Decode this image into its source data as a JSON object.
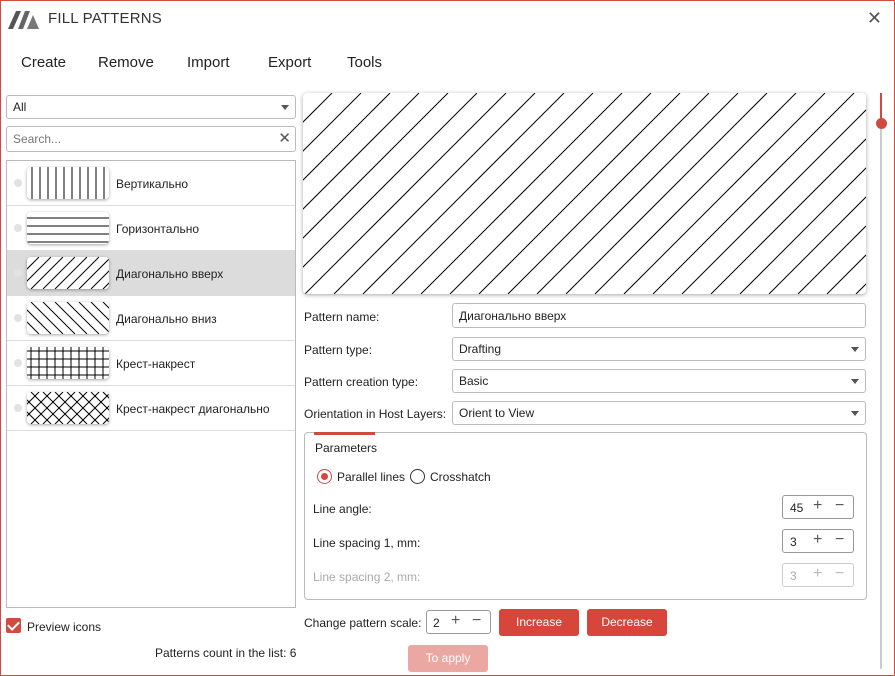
{
  "window": {
    "title": "FILL PATTERNS",
    "close_symbol": "✕"
  },
  "menu": {
    "items": [
      "Create",
      "Remove",
      "Import",
      "Export",
      "Tools"
    ]
  },
  "filter": {
    "selected": "All"
  },
  "search": {
    "placeholder": "Search...",
    "value": ""
  },
  "patterns": [
    {
      "label": "Вертикально",
      "pattern": "vertical",
      "selected": false
    },
    {
      "label": "Горизонтально",
      "pattern": "horizontal",
      "selected": false
    },
    {
      "label": "Диагонально вверх",
      "pattern": "diagonal-up",
      "selected": true
    },
    {
      "label": "Диагонально вниз",
      "pattern": "diagonal-down",
      "selected": false
    },
    {
      "label": "Крест-накрест",
      "pattern": "crosshatch",
      "selected": false
    },
    {
      "label": "Крест-накрест диагонально",
      "pattern": "diagonal-crosshatch",
      "selected": false
    }
  ],
  "properties": {
    "name_label": "Pattern name:",
    "name_value": "Диагонально вверх",
    "type_label": "Pattern type:",
    "type_value": "Drafting",
    "creation_label": "Pattern creation type:",
    "creation_value": "Basic",
    "orientation_label": "Orientation in Host Layers:",
    "orientation_value": "Orient to View"
  },
  "parameters": {
    "title": "Parameters",
    "parallel_label": "Parallel lines",
    "crosshatch_label": "Crosshatch",
    "selected_mode": "Parallel lines",
    "angle_label": "Line angle:",
    "angle_value": "45",
    "spacing1_label": "Line spacing 1, mm:",
    "spacing1_value": "3",
    "spacing2_label": "Line spacing 2, mm:",
    "spacing2_value": "3"
  },
  "scale": {
    "label": "Change pattern scale:",
    "value": "2",
    "increase_label": "Increase",
    "decrease_label": "Decrease"
  },
  "stepper_symbols": {
    "plus": "+",
    "minus": "−"
  },
  "apply_label": "To apply",
  "preview_icons_label": "Preview icons",
  "count_text": "Patterns count in the list: 6",
  "colors": {
    "accent": "#d04a42",
    "button": "#d8453b",
    "button_disabled": "#eba8a3",
    "selected_row": "#dcdcdc"
  },
  "icons": {
    "logo": "app-logo",
    "close": "close-icon",
    "dropdown": "chevron-down-icon",
    "clear": "clear-search-icon"
  }
}
